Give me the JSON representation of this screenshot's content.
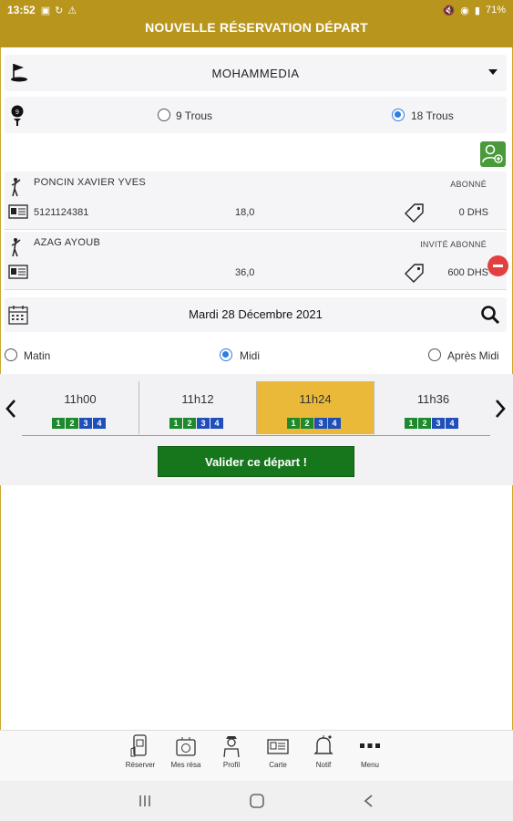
{
  "statusbar": {
    "time": "13:52",
    "battery": "71%"
  },
  "header": {
    "title": "NOUVELLE RÉSERVATION DÉPART"
  },
  "club": {
    "name": "MOHAMMEDIA",
    "icon": "golf-flag-icon",
    "dropdown_icon": "chevron-down-icon"
  },
  "holes": {
    "option_9": "9 Trous",
    "option_18": "18 Trous",
    "selected": "18 Trous"
  },
  "players": [
    {
      "name": "PONCIN XAVIER YVES",
      "type": "ABONNÉ",
      "id": "5121124381",
      "handicap": "18,0",
      "price": "0 DHS"
    },
    {
      "name": "AZAG AYOUB",
      "type": "INVITÉ ABONNÉ",
      "id": "",
      "handicap": "36,0",
      "price": "600 DHS"
    }
  ],
  "date": {
    "label": "Mardi 28 Décembre 2021"
  },
  "periods": {
    "morning": "Matin",
    "noon": "Midi",
    "afternoon": "Après Midi",
    "selected": "Midi"
  },
  "slots": [
    {
      "time": "11h00",
      "selected": false
    },
    {
      "time": "11h12",
      "selected": false
    },
    {
      "time": "11h24",
      "selected": true
    },
    {
      "time": "11h36",
      "selected": false
    }
  ],
  "slot_numbers": [
    "1",
    "2",
    "3",
    "4"
  ],
  "validate_label": "Valider ce départ !",
  "bottom_nav": [
    {
      "label": "Réserver",
      "icon": "phone-calendar-icon"
    },
    {
      "label": "Mes résa",
      "icon": "golf-bag-icon"
    },
    {
      "label": "Profil",
      "icon": "golfer-profile-icon"
    },
    {
      "label": "Carte",
      "icon": "member-card-icon"
    },
    {
      "label": "Notif",
      "icon": "bell-icon"
    },
    {
      "label": "Menu",
      "icon": "more-dots-icon"
    }
  ],
  "colors": {
    "header": "#b8961e",
    "selected_slot": "#eab93a",
    "validate": "#16761c",
    "radio_on": "#2d7fe0",
    "remove": "#e24040",
    "add_player": "#4a9a3c"
  }
}
